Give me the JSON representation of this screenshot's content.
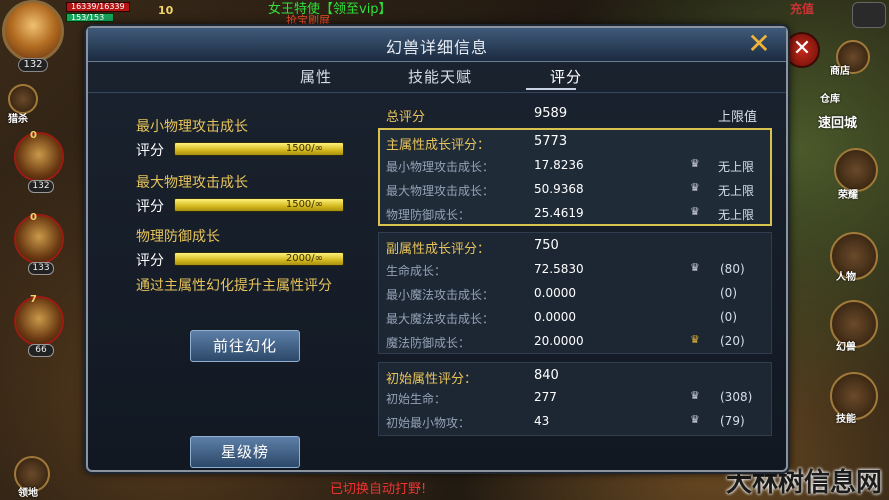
{
  "hud": {
    "hp": "16339/16339",
    "mp": "153/153",
    "hero_level": "132",
    "vip": "10",
    "top_name": "女王特使【领至vip】",
    "top_sub": "抢宝刷屏",
    "left_labels": [
      "猎杀",
      "领地"
    ],
    "pets": [
      {
        "stars": "0",
        "level": "132"
      },
      {
        "stars": "0",
        "level": "133"
      },
      {
        "stars": "7",
        "level": "66"
      }
    ],
    "right_icons": [
      "商店",
      "仓库",
      "速回城",
      "荣耀",
      "人物",
      "幻兽",
      "技能"
    ],
    "right_top": "充值",
    "bottom_text": "已切换自动打野!",
    "watermark": "大林树信息网"
  },
  "dialog": {
    "title": "幻兽详细信息",
    "tabs": [
      "属性",
      "技能天赋",
      "评分"
    ],
    "active_tab": 2
  },
  "left": {
    "growth": [
      {
        "title": "最小物理攻击成长",
        "label": "评分",
        "bar_text": "1500/∞",
        "fill": 1.0
      },
      {
        "title": "最大物理攻击成长",
        "label": "评分",
        "bar_text": "1500/∞",
        "fill": 1.0
      },
      {
        "title": "物理防御成长",
        "label": "评分",
        "bar_text": "2000/∞",
        "fill": 1.0
      }
    ],
    "tip": "通过主属性幻化提升主属性评分",
    "btn_transform": "前往幻化",
    "btn_ranking": "星级榜"
  },
  "right": {
    "total_label": "总评分",
    "total_value": "9589",
    "cap_label": "上限值",
    "main": {
      "label": "主属性成长评分：",
      "value": "5773",
      "rows": [
        {
          "label": "最小物理攻击成长：",
          "value": "17.8236",
          "cap": "无上限"
        },
        {
          "label": "最大物理攻击成长：",
          "value": "50.9368",
          "cap": "无上限"
        },
        {
          "label": "物理防御成长：",
          "value": "25.4619",
          "cap": "无上限"
        }
      ]
    },
    "sub": {
      "label": "副属性成长评分：",
      "value": "750",
      "rows": [
        {
          "label": "生命成长：",
          "value": "72.5830",
          "cap": "(80)",
          "crown": "silver"
        },
        {
          "label": "最小魔法攻击成长：",
          "value": "0.0000",
          "cap": "(0)",
          "crown": ""
        },
        {
          "label": "最大魔法攻击成长：",
          "value": "0.0000",
          "cap": "(0)",
          "crown": ""
        },
        {
          "label": "魔法防御成长：",
          "value": "20.0000",
          "cap": "(20)",
          "crown": "gold"
        }
      ]
    },
    "init": {
      "label": "初始属性评分：",
      "value": "840",
      "rows": [
        {
          "label": "初始生命：",
          "value": "277",
          "cap": "(308)",
          "crown": "silver"
        },
        {
          "label": "初始最小物攻：",
          "value": "43",
          "cap": "(79)",
          "crown": "silver"
        }
      ]
    }
  }
}
